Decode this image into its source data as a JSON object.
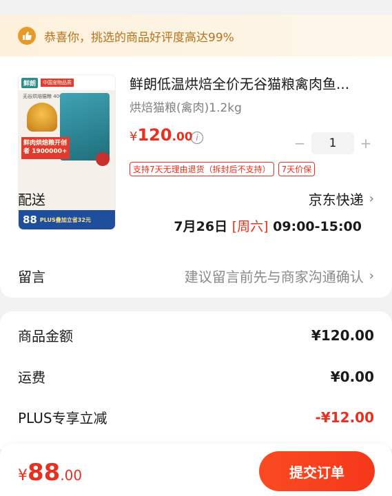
{
  "notice": {
    "text": "恭喜你，挑选的商品好评度高达99%"
  },
  "product": {
    "title": "鲜朗低温烘焙全价无谷猫粮禽肉鱼...",
    "spec": "烘焙猫粮(禽肉)1.2kg",
    "price_currency": "¥",
    "price_int": "120",
    "price_dec": ".00",
    "quantity": "1",
    "minus_label": "−",
    "plus_label": "+",
    "badges": [
      "支持7天无理由退货（拆封后不支持）",
      "7天价保"
    ],
    "thumb": {
      "brand": "鲜朗",
      "tag": "中国宠物品质",
      "sub": "无谷烘焙猫粮 400g*3",
      "promo": "鲜肉烘焙粮开创者 1900000+",
      "price": "88",
      "plus": "PLUS叠加立省32元"
    }
  },
  "delivery": {
    "label": "配送",
    "value": "京东快递",
    "date": "7月26日",
    "day": "[周六]",
    "time": "09:00-15:00"
  },
  "note": {
    "label": "留言",
    "placeholder": "建议留言前先与商家沟通确认"
  },
  "summary": {
    "rows": [
      {
        "label": "商品金额",
        "value": "¥120.00"
      },
      {
        "label": "运费",
        "value": "¥0.00"
      },
      {
        "label": "PLUS专享立减",
        "value": "-¥12.00"
      }
    ]
  },
  "footer": {
    "currency": "¥",
    "total_int": "88",
    "total_dec": ".00",
    "submit_label": "提交订单"
  },
  "colors": {
    "accent": "#e8301e",
    "notice_text": "#b8721c",
    "notice_icon": "#e89a28"
  }
}
